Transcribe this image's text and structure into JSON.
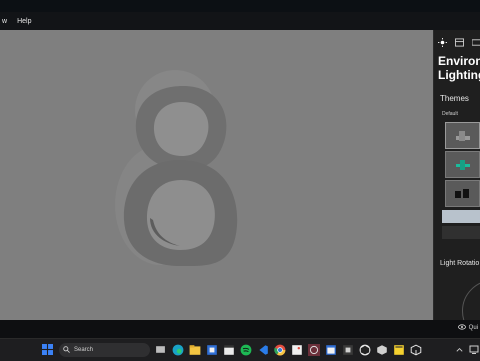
{
  "menu": {
    "items": [
      "w",
      "Help"
    ]
  },
  "panel": {
    "title_line1": "Environm",
    "title_line2": "Lighting",
    "themes_label": "Themes",
    "default_label": "Default",
    "light_rotation_label": "Light Rotatio",
    "icons": [
      "sun-icon",
      "layout-icon",
      "ruler-icon"
    ]
  },
  "status": {
    "quick_label": "Qui"
  },
  "taskbar": {
    "search_placeholder": "Search",
    "icons": [
      "windows-start-icon",
      "search-icon",
      "task-view-icon",
      "edge-icon",
      "file-explorer-icon",
      "app-icon",
      "clapper-icon",
      "spotify-icon",
      "vscode-icon",
      "chrome-icon",
      "photos-icon",
      "3d-viewer-icon",
      "calendar-icon",
      "office-icon",
      "unity-icon",
      "sticky-notes-icon",
      "cube-icon"
    ]
  },
  "colors": {
    "viewport_bg": "#7f7f7f",
    "panel_bg": "#1f1f1f",
    "accent_teal": "#1abc9c",
    "taskbar_bg": "#1e1e20"
  }
}
